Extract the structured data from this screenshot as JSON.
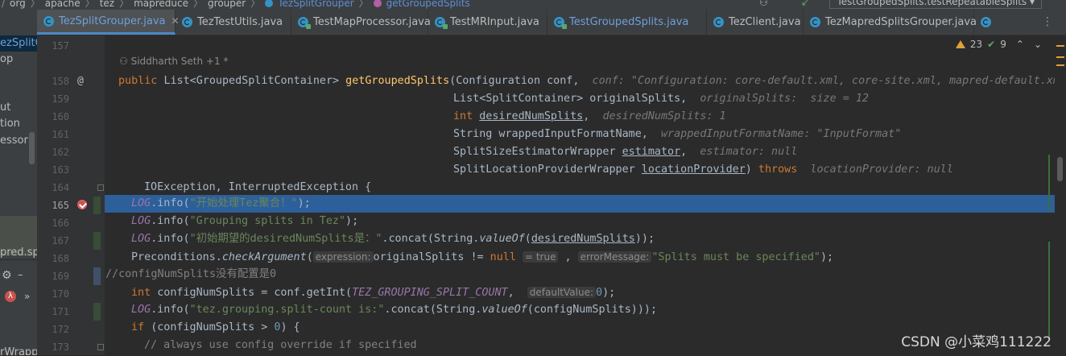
{
  "breadcrumb": {
    "items": [
      "org",
      "apache",
      "tez",
      "mapreduce",
      "grouper",
      "TezSplitGrouper",
      "getGroupedSplits"
    ],
    "run_config": "TestGroupedSplits.testRepeatableSplits"
  },
  "tabs": [
    {
      "label": "TezSplitGrouper.java",
      "active": true,
      "icon": "class-icon",
      "color_blue": true
    },
    {
      "label": "TezTestUtils.java",
      "active": false,
      "icon": "class-icon"
    },
    {
      "label": "TestMapProcessor.java",
      "active": false,
      "icon": "test-class-icon"
    },
    {
      "label": "TestMRInput.java",
      "active": false,
      "icon": "test-class-icon"
    },
    {
      "label": "TestGroupedSplits.java",
      "active": false,
      "icon": "test-class-icon",
      "color_blue": true
    },
    {
      "label": "TezClient.java",
      "active": false,
      "icon": "class-icon"
    },
    {
      "label": "TezMapredSplitsGrouper.java",
      "active": false,
      "icon": "class-icon"
    }
  ],
  "project_pane": {
    "items": [
      "ezSplitGr",
      "op",
      "ut",
      "tion",
      "essor",
      "pred.sp",
      "rWrapp"
    ]
  },
  "inspections": {
    "warnings": "23",
    "ok": "9"
  },
  "editor": {
    "author": "Siddharth Seth +1 *",
    "line_numbers": [
      "157",
      "158",
      "159",
      "160",
      "161",
      "162",
      "163",
      "164",
      "165",
      "166",
      "167",
      "168",
      "169",
      "170",
      "171",
      "172",
      "173"
    ],
    "current_line": "165",
    "code": {
      "l158_a": "public ",
      "l158_b": "List<GroupedSplitContainer> ",
      "l158_fn": "getGroupedSplits",
      "l158_c": "(Configuration conf,  ",
      "l158_hint": "conf: \"Configuration: core-default.xml, core-site.xml, mapred-default.xml",
      "l159_a": "List<SplitContainer> originalSplits,  ",
      "l159_hint": "originalSplits:  size = 12",
      "l160_kw": "int ",
      "l160_var": "desiredNumSplits",
      "l160_b": ",  ",
      "l160_hint": "desiredNumSplits: 1",
      "l161_a": "String wrappedInputFormatName,  ",
      "l161_hint": "wrappedInputFormatName: \"InputFormat\"",
      "l162_a": "SplitSizeEstimatorWrapper ",
      "l162_var": "estimator",
      "l162_b": ",  ",
      "l162_hint": "estimator: null",
      "l163_a": "SplitLocationProviderWrapper ",
      "l163_var": "locationProvider",
      "l163_b": ") ",
      "l163_kw": "throws",
      "l163_hint": "locationProvider: null",
      "l164": "IOException, InterruptedException {",
      "l165_log": "LOG",
      "l165_a": ".info(",
      "l165_str": "\"开始处理Tez聚合！\"",
      "l165_b": ");",
      "l166_log": "LOG",
      "l166_a": ".info(",
      "l166_str": "\"Grouping splits in Tez\"",
      "l166_b": ");",
      "l167_log": "LOG",
      "l167_a": ".info(",
      "l167_str": "\"初始期望的desiredNumSplits是：\"",
      "l167_b": ".concat(String.",
      "l167_static": "valueOf",
      "l167_c": "(",
      "l167_var": "desiredNumSplits",
      "l167_d": "));",
      "l168_a": "Preconditions.",
      "l168_static": "checkArgument",
      "l168_b": "(",
      "l168_p1": "expression:",
      "l168_c": "originalSplits != ",
      "l168_kw": "null",
      "l168_p2": "= true",
      "l168_d": " , ",
      "l168_p3": "errorMessage:",
      "l168_str": "\"Splits must be specified\"",
      "l168_e": ");",
      "l169": "//configNumSplits没有配置是0",
      "l170_kw": "int ",
      "l170_a": "configNumSplits = conf.getInt(",
      "l170_const": "TEZ_GROUPING_SPLIT_COUNT",
      "l170_b": ",  ",
      "l170_p": "defaultValue:",
      "l170_num": "0",
      "l170_c": ");",
      "l171_log": "LOG",
      "l171_a": ".info(",
      "l171_str": "\"tez.grouping.split-count is:\"",
      "l171_b": ".concat(String.",
      "l171_static": "valueOf",
      "l171_c": "(configNumSplits)));",
      "l172_kw": "if ",
      "l172_a": "(configNumSplits > ",
      "l172_num": "0",
      "l172_b": ") {",
      "l173": "// always use config override if specified"
    }
  },
  "watermark": "CSDN @小菜鸡111222",
  "colors": {
    "selection": "#2d5f9a",
    "keyword": "#cc7832",
    "string": "#6a8759",
    "method": "#ffc66d"
  }
}
